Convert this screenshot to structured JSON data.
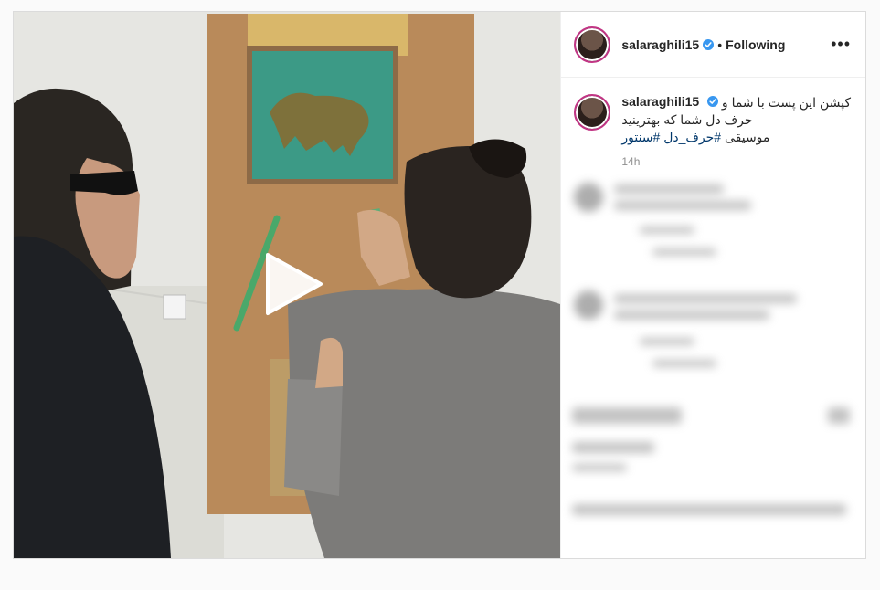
{
  "post": {
    "username": "salaraghili15",
    "follow_separator": "•",
    "follow_status": "Following",
    "more_label": "•••",
    "caption_username": "salaraghili15",
    "caption_line1": "کپشن این پست با شما و",
    "caption_line2": "حرف دل شما که بهترینید",
    "caption_tags_prefix": "موسیقی",
    "caption_tags": "#حرف_دل #سنتور",
    "timestamp": "14h"
  },
  "icons": {
    "verified": "verified-badge-icon",
    "play": "play-icon",
    "more": "more-options-icon"
  },
  "colors": {
    "verified_blue": "#3897f0",
    "hashtag": "#00376b"
  }
}
